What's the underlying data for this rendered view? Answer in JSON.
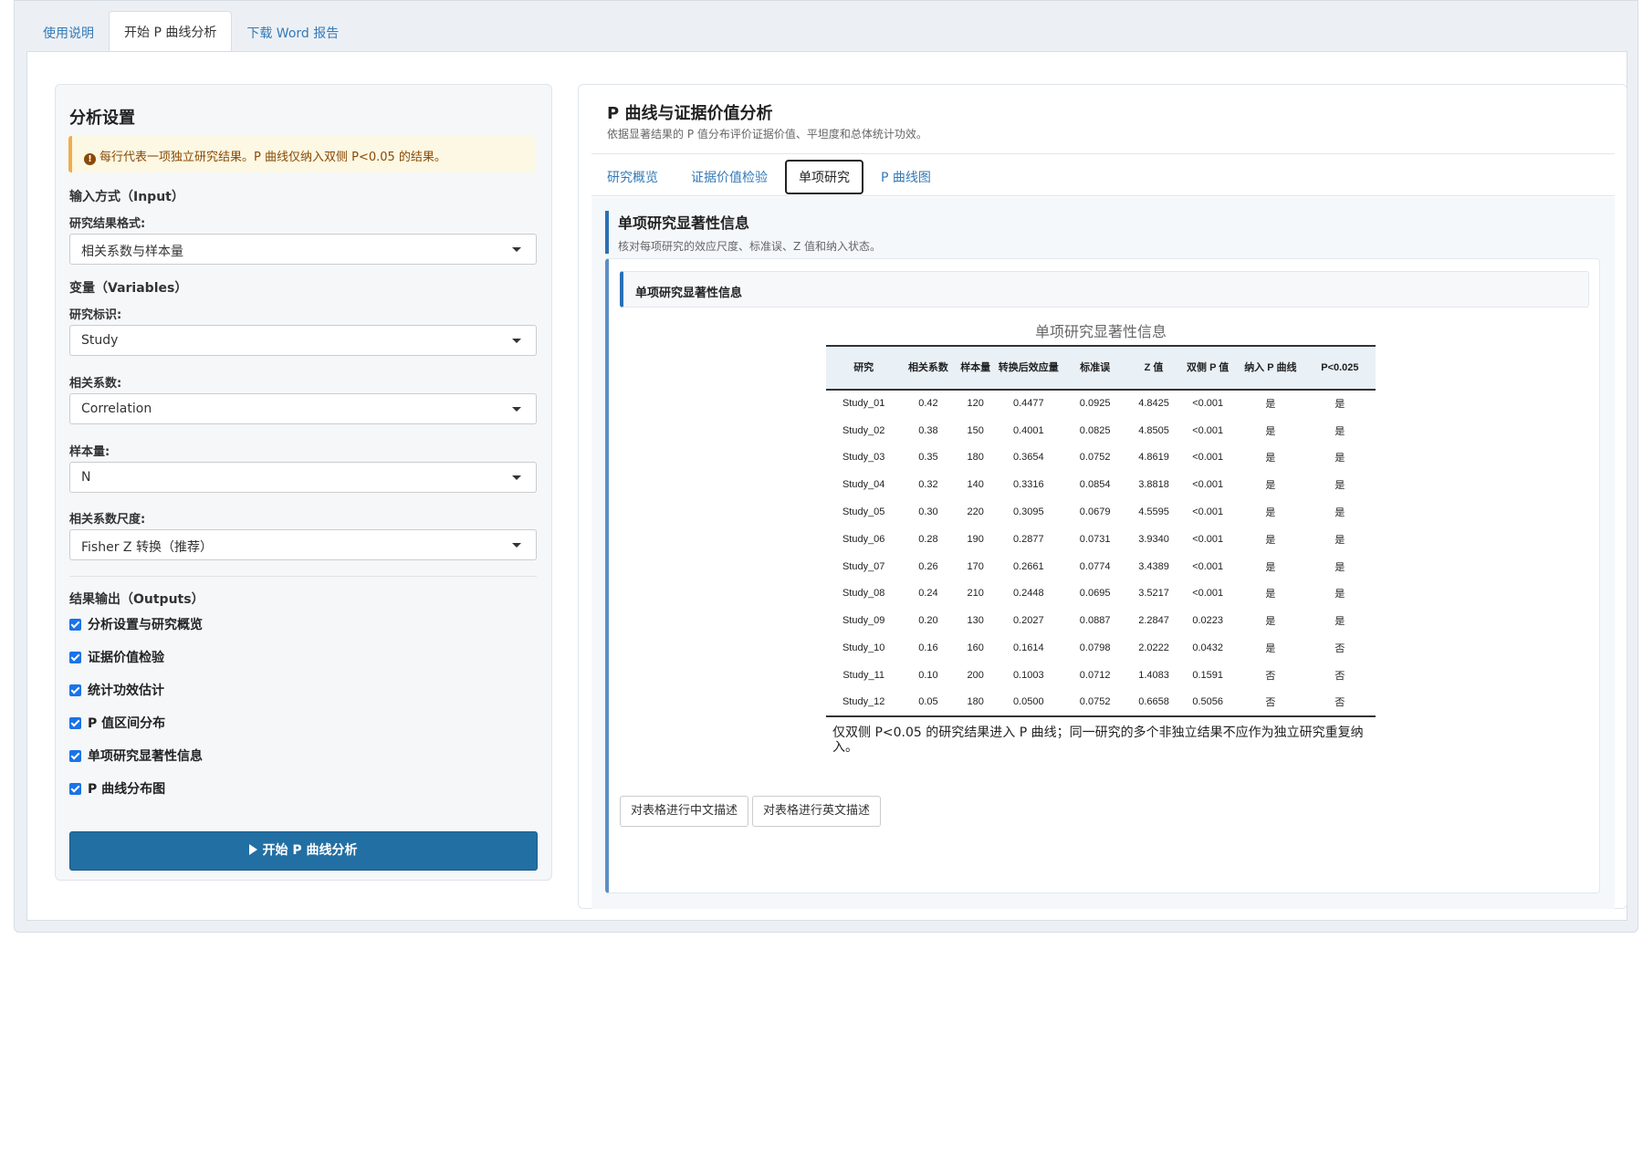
{
  "top_tabs": [
    {
      "label": "使用说明"
    },
    {
      "label": "开始 P 曲线分析"
    },
    {
      "label": "下载 Word 报告"
    }
  ],
  "sidebar": {
    "title": "分析设置",
    "alert": "每行代表一项独立研究结果。P 曲线仅纳入双侧 P<0.05 的结果。",
    "input_section": "输入方式（Input）",
    "format_label": "研究结果格式:",
    "format_value": "相关系数与样本量",
    "variables_section": "变量（Variables）",
    "study_label": "研究标识:",
    "study_value": "Study",
    "corr_label": "相关系数:",
    "corr_value": "Correlation",
    "n_label": "样本量:",
    "n_value": "N",
    "scale_label": "相关系数尺度:",
    "scale_value": "Fisher Z 转换（推荐）",
    "outputs_section": "结果输出（Outputs）",
    "outputs": [
      {
        "label": "分析设置与研究概览",
        "checked": true
      },
      {
        "label": "证据价值检验",
        "checked": true
      },
      {
        "label": "统计功效估计",
        "checked": true
      },
      {
        "label": "P 值区间分布",
        "checked": true
      },
      {
        "label": "单项研究显著性信息",
        "checked": true
      },
      {
        "label": "P 曲线分布图",
        "checked": true
      }
    ],
    "run_button": "开始 P 曲线分析"
  },
  "main": {
    "title": "P 曲线与证据价值分析",
    "subtitle": "依据显著结果的 P 值分布评价证据价值、平坦度和总体统计功效。",
    "tabs": [
      {
        "label": "研究概览"
      },
      {
        "label": "证据价值检验"
      },
      {
        "label": "单项研究"
      },
      {
        "label": "P 曲线图"
      }
    ],
    "pane_title": "单项研究显著性信息",
    "pane_desc": "核对每项研究的效应尺度、标准误、Z 值和纳入状态。",
    "card_title": "单项研究显著性信息",
    "table": {
      "caption": "单项研究显著性信息",
      "headers": [
        "研究",
        "相关系数",
        "样本量",
        "转换后效应量",
        "标准误",
        "Z 值",
        "双侧 P 值",
        "纳入 P 曲线",
        "P<0.025"
      ],
      "rows": [
        [
          "Study_01",
          "0.42",
          "120",
          "0.4477",
          "0.0925",
          "4.8425",
          "<0.001",
          "是",
          "是"
        ],
        [
          "Study_02",
          "0.38",
          "150",
          "0.4001",
          "0.0825",
          "4.8505",
          "<0.001",
          "是",
          "是"
        ],
        [
          "Study_03",
          "0.35",
          "180",
          "0.3654",
          "0.0752",
          "4.8619",
          "<0.001",
          "是",
          "是"
        ],
        [
          "Study_04",
          "0.32",
          "140",
          "0.3316",
          "0.0854",
          "3.8818",
          "<0.001",
          "是",
          "是"
        ],
        [
          "Study_05",
          "0.30",
          "220",
          "0.3095",
          "0.0679",
          "4.5595",
          "<0.001",
          "是",
          "是"
        ],
        [
          "Study_06",
          "0.28",
          "190",
          "0.2877",
          "0.0731",
          "3.9340",
          "<0.001",
          "是",
          "是"
        ],
        [
          "Study_07",
          "0.26",
          "170",
          "0.2661",
          "0.0774",
          "3.4389",
          "<0.001",
          "是",
          "是"
        ],
        [
          "Study_08",
          "0.24",
          "210",
          "0.2448",
          "0.0695",
          "3.5217",
          "<0.001",
          "是",
          "是"
        ],
        [
          "Study_09",
          "0.20",
          "130",
          "0.2027",
          "0.0887",
          "2.2847",
          "0.0223",
          "是",
          "是"
        ],
        [
          "Study_10",
          "0.16",
          "160",
          "0.1614",
          "0.0798",
          "2.0222",
          "0.0432",
          "是",
          "否"
        ],
        [
          "Study_11",
          "0.10",
          "200",
          "0.1003",
          "0.0712",
          "1.4083",
          "0.1591",
          "否",
          "否"
        ],
        [
          "Study_12",
          "0.05",
          "180",
          "0.0500",
          "0.0752",
          "0.6658",
          "0.5056",
          "否",
          "否"
        ]
      ],
      "note": "仅双侧 P<0.05 的研究结果进入 P 曲线；同一研究的多个非独立结果不应作为独立研究重复纳入。"
    },
    "desc_buttons": [
      "对表格进行中文描述",
      "对表格进行英文描述"
    ]
  }
}
